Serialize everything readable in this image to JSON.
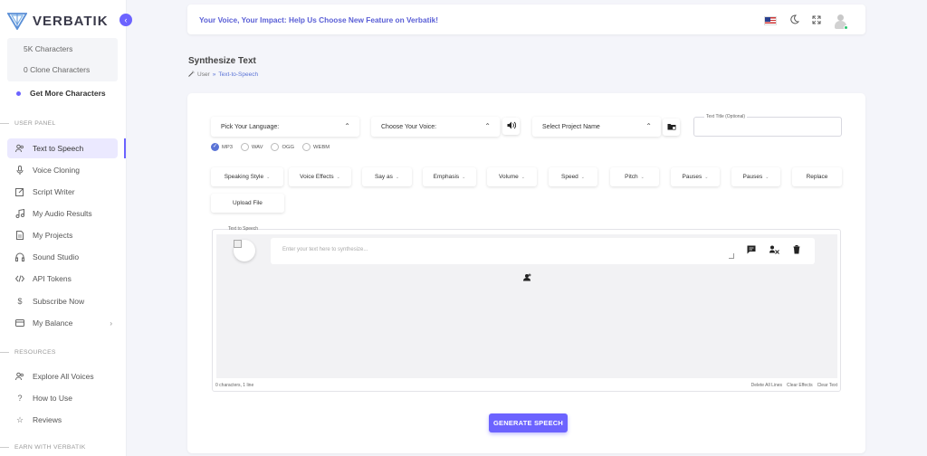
{
  "brand": {
    "name": "VERBATIK"
  },
  "sidebar": {
    "chars": [
      "5K Characters",
      "0 Clone Characters"
    ],
    "get_more": "Get More Characters",
    "user_panel_label": "USER PANEL",
    "items": [
      {
        "label": "Text to Speech",
        "icon": "users-icon"
      },
      {
        "label": "Voice Cloning",
        "icon": "mic-icon"
      },
      {
        "label": "Script Writer",
        "icon": "edit-icon"
      },
      {
        "label": "My Audio Results",
        "icon": "music-icon"
      },
      {
        "label": "My Projects",
        "icon": "file-icon"
      },
      {
        "label": "Sound Studio",
        "icon": "headphones-icon"
      },
      {
        "label": "API Tokens",
        "icon": "code-icon"
      },
      {
        "label": "Subscribe Now",
        "icon": "dollar-icon"
      },
      {
        "label": "My Balance",
        "icon": "wallet-icon"
      }
    ],
    "resources_label": "RESOURCES",
    "resources": [
      {
        "label": "Explore All Voices",
        "icon": "users-icon"
      },
      {
        "label": "How to Use",
        "icon": "question-icon"
      },
      {
        "label": "Reviews",
        "icon": "star-icon"
      }
    ],
    "earn_label": "EARN WITH VERBATIK"
  },
  "topbar": {
    "banner": "Your Voice, Your Impact: Help Us Choose New Feature on Verbatik!"
  },
  "page": {
    "title": "Synthesize Text",
    "breadcrumb_root": "User",
    "breadcrumb_sep": "»",
    "breadcrumb_current": "Text-to-Speech"
  },
  "form": {
    "language": "Pick Your Language:",
    "voice": "Choose Your Voice:",
    "project": "Select Project Name",
    "text_title_label": "Text Title (Optional)",
    "formats": [
      "MP3",
      "WAV",
      "OGG",
      "WEBM"
    ],
    "selected_format": "MP3",
    "tools": [
      "Speaking Style",
      "Voice Effects",
      "Say as",
      "Emphasis",
      "Volume",
      "Speed",
      "Pitch",
      "Pauses",
      "Pauses",
      "Replace"
    ],
    "upload": "Upload File"
  },
  "editor": {
    "label": "Text to Speech",
    "placeholder": "Enter your text here to synthesize...",
    "status": "0 characters, 1 line",
    "actions": [
      "Delete All Lines",
      "Clear Effects",
      "Clear Text"
    ]
  },
  "generate": "GENERATE SPEECH",
  "colors": {
    "accent": "#6c63ff",
    "banner_text": "#5a5fd6",
    "link": "#5a73d6"
  }
}
